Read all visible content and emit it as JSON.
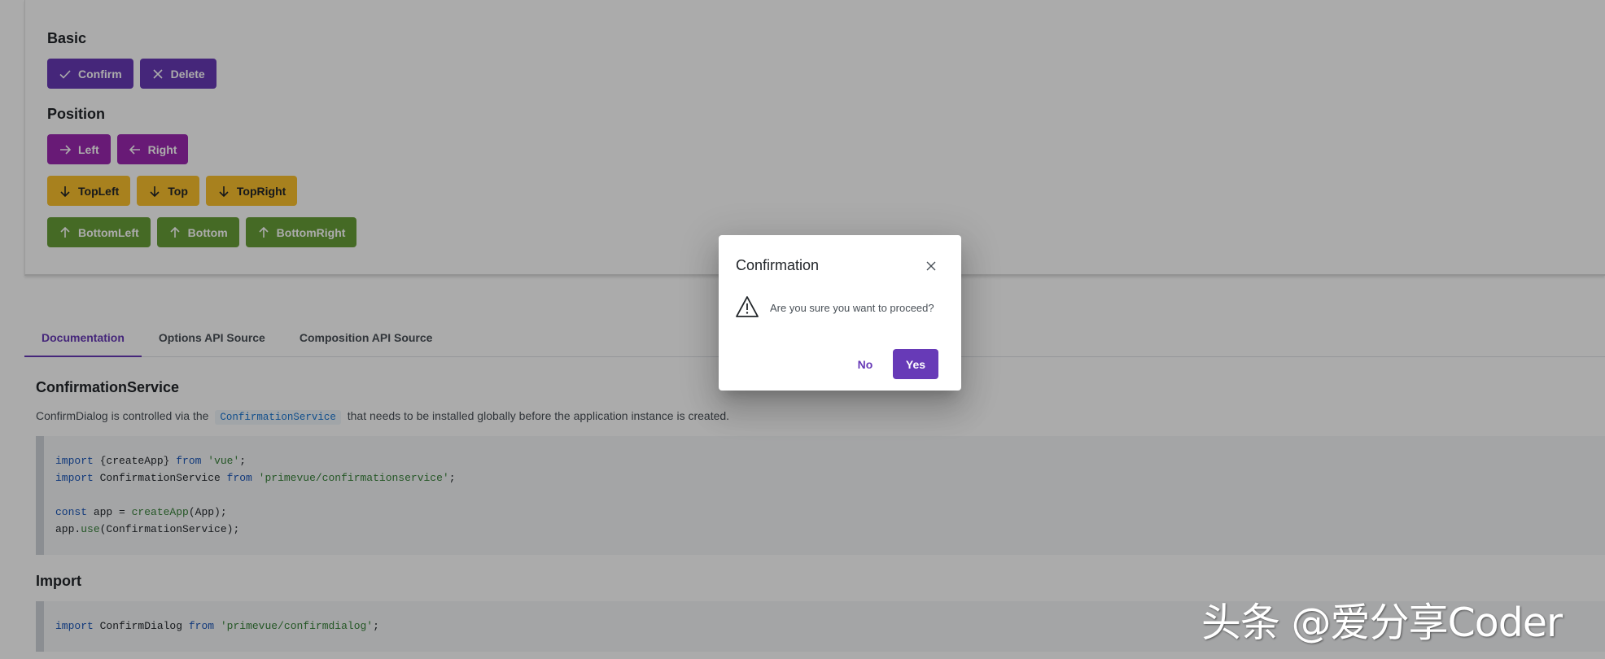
{
  "basic": {
    "title": "Basic",
    "buttons": [
      {
        "label": "Confirm",
        "icon": "check-icon"
      },
      {
        "label": "Delete",
        "icon": "close-icon"
      }
    ]
  },
  "position": {
    "title": "Position",
    "row1": [
      {
        "label": "Left",
        "icon": "arrow-right-icon"
      },
      {
        "label": "Right",
        "icon": "arrow-left-icon"
      }
    ],
    "row2": [
      {
        "label": "TopLeft",
        "icon": "arrow-down-icon"
      },
      {
        "label": "Top",
        "icon": "arrow-down-icon"
      },
      {
        "label": "TopRight",
        "icon": "arrow-down-icon"
      }
    ],
    "row3": [
      {
        "label": "BottomLeft",
        "icon": "arrow-up-icon"
      },
      {
        "label": "Bottom",
        "icon": "arrow-up-icon"
      },
      {
        "label": "BottomRight",
        "icon": "arrow-up-icon"
      }
    ]
  },
  "tabs": [
    {
      "label": "Documentation",
      "active": true
    },
    {
      "label": "Options API Source",
      "active": false
    },
    {
      "label": "Composition API Source",
      "active": false
    }
  ],
  "docs": {
    "service_heading": "ConfirmationService",
    "service_text_before": "ConfirmDialog is controlled via the",
    "service_code": "ConfirmationService",
    "service_text_after": "that needs to be installed globally before the application instance is created.",
    "code1": [
      "import {createApp} from 'vue';",
      "import ConfirmationService from 'primevue/confirmationservice';",
      "",
      "const app = createApp(App);",
      "app.use(ConfirmationService);"
    ],
    "import_heading": "Import",
    "code2": [
      "import ConfirmDialog from 'primevue/confirmdialog';"
    ]
  },
  "dialog": {
    "title": "Confirmation",
    "message": "Are you sure you want to proceed?",
    "no_label": "No",
    "yes_label": "Yes",
    "icon": "warning-triangle-icon"
  },
  "watermark": "头条 @爱分享Coder",
  "colors": {
    "primary": "#673ab7",
    "help": "#9c27b0",
    "warning": "#fbc02d",
    "success": "#689f38"
  }
}
